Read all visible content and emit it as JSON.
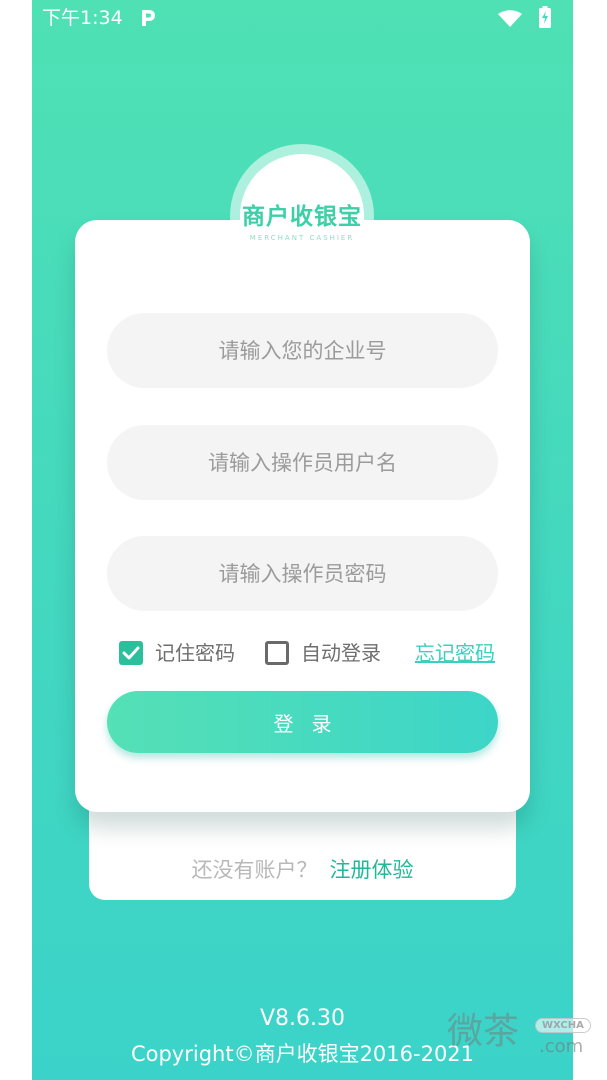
{
  "status_bar": {
    "time": "下午1:34",
    "icons": [
      "parking-p-icon",
      "wifi-icon",
      "battery-charging-icon"
    ]
  },
  "logo": {
    "name": "商户收银宝",
    "subtitle": "MERCHANT CASHIER"
  },
  "form": {
    "company_placeholder": "请输入您的企业号",
    "company_value": "",
    "username_placeholder": "请输入操作员用户名",
    "username_value": "",
    "password_placeholder": "请输入操作员密码",
    "password_value": "",
    "remember_label": "记住密码",
    "remember_checked": true,
    "auto_login_label": "自动登录",
    "auto_login_checked": false,
    "forgot_label": "忘记密码",
    "login_label": "登录"
  },
  "register": {
    "hint": "还没有账户？",
    "link": "注册体验"
  },
  "footer": {
    "version": "V8.6.30",
    "copyright": "Copyright©商户收银宝2016-2021"
  },
  "watermark": {
    "text": "微茶",
    "badge": "WXCHA",
    "domain": ".com"
  },
  "colors": {
    "gradient_top": "#4fe1b4",
    "gradient_bottom": "#3bd3c9",
    "accent": "#2cbf9c",
    "link": "#3ccfc0"
  }
}
